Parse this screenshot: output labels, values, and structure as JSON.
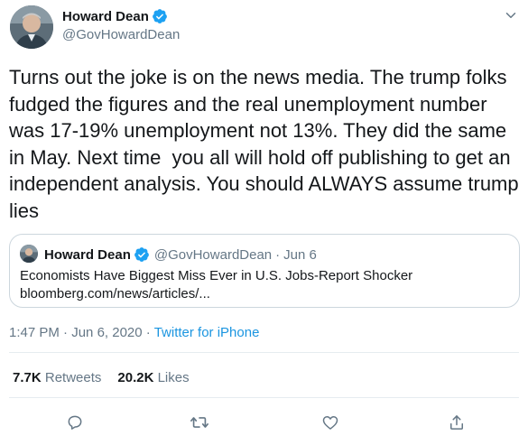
{
  "author": {
    "name": "Howard Dean",
    "handle": "@GovHowardDean",
    "avatar_icon": "avatar-photo",
    "verified_icon": "verified-badge-icon"
  },
  "tweet": {
    "text": "Turns out the joke is on the news media. The trump folks fudged the figures and the real unemployment number was 17-19% unemployment not 13%. They did the same in May. Next time  you all will hold off publishing to get an independent analysis. You should ALWAYS assume trump lies"
  },
  "quoted": {
    "name": "Howard Dean",
    "handle": "@GovHowardDean",
    "separator": "·",
    "date": "Jun 6",
    "title": "Economists Have Biggest Miss Ever in U.S. Jobs-Report Shocker",
    "link": "bloomberg.com/news/articles/..."
  },
  "meta": {
    "time": "1:47 PM",
    "separator1": " · ",
    "date": "Jun 6, 2020",
    "separator2": " · ",
    "source": "Twitter for iPhone"
  },
  "stats": {
    "retweets_count": "7.7K",
    "retweets_label": "Retweets",
    "likes_count": "20.2K",
    "likes_label": "Likes"
  },
  "colors": {
    "text": "#14171a",
    "secondary": "#657786",
    "accent": "#1da1f2",
    "link": "#1b95e0",
    "border": "#ccd6dd"
  }
}
